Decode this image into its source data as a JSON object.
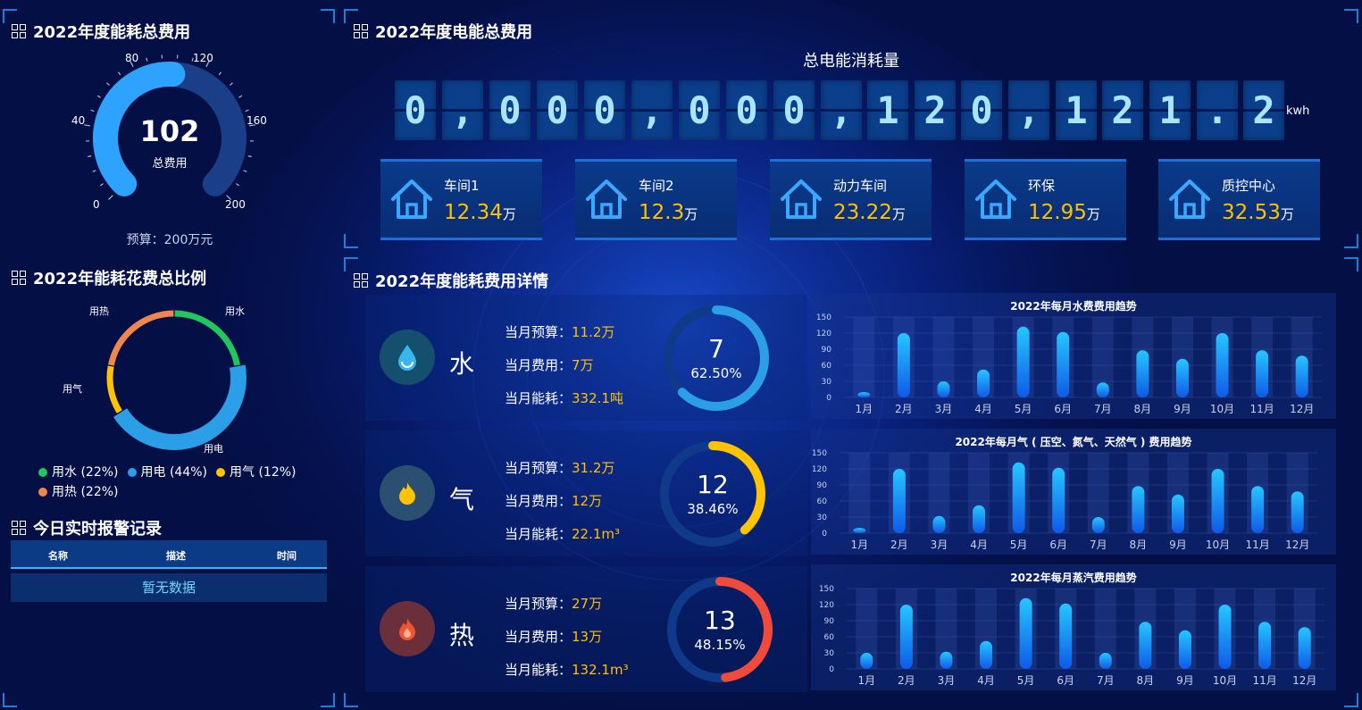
{
  "colors": {
    "accent": "#1d7fd6",
    "yellow": "#ffc000",
    "water": "#2a9fe8",
    "gas": "#ffc300",
    "heat": "#f04b3a",
    "green": "#22c55e",
    "orange": "#f0864e"
  },
  "left_top": {
    "title": "2022年度能耗总费用",
    "value": "102",
    "value_label": "总费用",
    "ticks": [
      "0",
      "40",
      "80",
      "120",
      "160",
      "200"
    ],
    "budget": "预算：200万元",
    "gauge_fraction": 0.51
  },
  "left_mid": {
    "title": "2022年能耗花费总比例",
    "labels": {
      "water": "用水",
      "elec": "用电",
      "gas": "用气",
      "heat": "用热"
    },
    "legend": [
      "用水 (22%)",
      "用电 (44%)",
      "用气 (12%)",
      "用热 (22%)"
    ],
    "shares": [
      22,
      44,
      12,
      22
    ]
  },
  "left_bot": {
    "title": "今日实时报警记录",
    "headers": [
      "名称",
      "描述",
      "时间"
    ],
    "empty": "暂无数据"
  },
  "elec": {
    "title": "2022年度电能总费用",
    "subtitle": "总电能消耗量",
    "digits": [
      "0",
      ",",
      "0",
      "0",
      "0",
      ",",
      "0",
      "0",
      "0",
      ",",
      "1",
      "2",
      "0",
      ",",
      "1",
      "2",
      "1",
      ".",
      "2"
    ],
    "unit": "kwh",
    "cards": [
      {
        "name": "车间1",
        "value": "12.34",
        "unit": "万"
      },
      {
        "name": "车间2",
        "value": "12.3",
        "unit": "万"
      },
      {
        "name": "动力车间",
        "value": "23.22",
        "unit": "万"
      },
      {
        "name": "环保",
        "value": "12.95",
        "unit": "万"
      },
      {
        "name": "质控中心",
        "value": "32.53",
        "unit": "万"
      }
    ]
  },
  "detail": {
    "title": "2022年度能耗费用详情",
    "rows": [
      {
        "name": "水",
        "l1": "当月预算：",
        "v1": "11.2万",
        "l2": "当月费用：",
        "v2": "7万",
        "l3": "当月能耗：",
        "v3": "332.1吨",
        "ring_num": "7",
        "ring_pct": "62.50%",
        "ring_fraction": 0.625,
        "color": "#2a9fe8"
      },
      {
        "name": "气",
        "l1": "当月预算：",
        "v1": "31.2万",
        "l2": "当月费用：",
        "v2": "12万",
        "l3": "当月能耗：",
        "v3": "22.1m³",
        "ring_num": "12",
        "ring_pct": "38.46%",
        "ring_fraction": 0.3846,
        "color": "#ffc300"
      },
      {
        "name": "热",
        "l1": "当月预算：",
        "v1": "27万",
        "l2": "当月费用：",
        "v2": "13万",
        "l3": "当月能耗：",
        "v3": "132.1m³",
        "ring_num": "13",
        "ring_pct": "48.15%",
        "ring_fraction": 0.4815,
        "color": "#f04b3a"
      }
    ]
  },
  "chart_data": [
    {
      "type": "bar",
      "title": "2022年每月水费费用趋势",
      "categories": [
        "1月",
        "2月",
        "3月",
        "4月",
        "5月",
        "6月",
        "7月",
        "8月",
        "9月",
        "10月",
        "11月",
        "12月"
      ],
      "values": [
        10,
        120,
        30,
        52,
        132,
        122,
        28,
        88,
        72,
        120,
        88,
        78
      ],
      "yticks": [
        "0",
        "30",
        "60",
        "90",
        "120",
        "150"
      ],
      "ylim": [
        0,
        150
      ]
    },
    {
      "type": "bar",
      "title": "2022年每月气 ( 压空、氮气、天然气 ) 费用趋势",
      "categories": [
        "1月",
        "2月",
        "3月",
        "4月",
        "5月",
        "6月",
        "7月",
        "8月",
        "9月",
        "10月",
        "11月",
        "12月"
      ],
      "values": [
        10,
        120,
        32,
        52,
        132,
        122,
        30,
        88,
        72,
        120,
        88,
        78
      ],
      "yticks": [
        "0",
        "30",
        "60",
        "90",
        "120",
        "150"
      ],
      "ylim": [
        0,
        150
      ]
    },
    {
      "type": "bar",
      "title": "2022年每月蒸汽费用趋势",
      "categories": [
        "1月",
        "2月",
        "3月",
        "4月",
        "5月",
        "6月",
        "7月",
        "8月",
        "9月",
        "10月",
        "11月",
        "12月"
      ],
      "values": [
        30,
        120,
        32,
        52,
        132,
        122,
        30,
        88,
        72,
        120,
        88,
        78
      ],
      "yticks": [
        "0",
        "30",
        "60",
        "90",
        "120",
        "150"
      ],
      "ylim": [
        0,
        150
      ]
    }
  ]
}
